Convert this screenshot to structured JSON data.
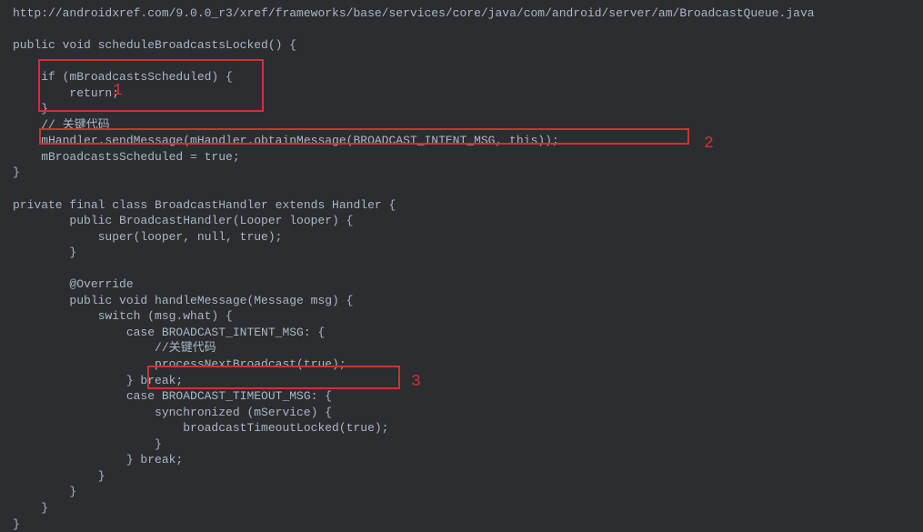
{
  "url": "http://androidxref.com/9.0.0_r3/xref/frameworks/base/services/core/java/com/android/server/am/BroadcastQueue.java",
  "code": {
    "line01": "public void scheduleBroadcastsLocked() {",
    "line02": "",
    "line03": "    if (mBroadcastsScheduled) {",
    "line04": "        return;",
    "line05": "    }",
    "line06": "    // 关键代码",
    "line07": "    mHandler.sendMessage(mHandler.obtainMessage(BROADCAST_INTENT_MSG, this));",
    "line08": "    mBroadcastsScheduled = true;",
    "line09": "}",
    "line10": "",
    "line11": "private final class BroadcastHandler extends Handler {",
    "line12": "        public BroadcastHandler(Looper looper) {",
    "line13": "            super(looper, null, true);",
    "line14": "        }",
    "line15": "",
    "line16": "        @Override",
    "line17": "        public void handleMessage(Message msg) {",
    "line18": "            switch (msg.what) {",
    "line19": "                case BROADCAST_INTENT_MSG: {",
    "line20": "                    //关键代码",
    "line21": "                    processNextBroadcast(true);",
    "line22": "                } break;",
    "line23": "                case BROADCAST_TIMEOUT_MSG: {",
    "line24": "                    synchronized (mService) {",
    "line25": "                        broadcastTimeoutLocked(true);",
    "line26": "                    }",
    "line27": "                } break;",
    "line28": "            }",
    "line29": "        }",
    "line30": "    }",
    "line31": "}"
  },
  "annotations": {
    "n1": "1",
    "n2": "2",
    "n3": "3"
  }
}
